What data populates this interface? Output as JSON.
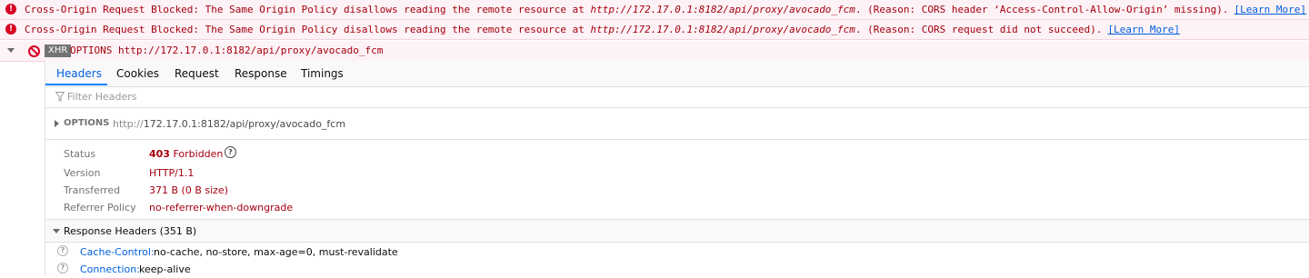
{
  "console": {
    "errors": [
      {
        "prefix": "Cross-Origin Request Blocked: The Same Origin Policy disallows reading the remote resource at ",
        "url": "http://172.17.0.1:8182/api/proxy/avocado_fcm",
        "suffix": ". (Reason: CORS header ‘Access-Control-Allow-Origin’ missing).",
        "learn_more": "[Learn More]"
      },
      {
        "prefix": "Cross-Origin Request Blocked: The Same Origin Policy disallows reading the remote resource at ",
        "url": "http://172.17.0.1:8182/api/proxy/avocado_fcm",
        "suffix": ". (Reason: CORS request did not succeed).",
        "learn_more": "[Learn More]"
      }
    ],
    "xhr": {
      "badge": "XHR",
      "text": "OPTIONS http://172.17.0.1:8182/api/proxy/avocado_fcm"
    },
    "error_icon": "!",
    "colors": {
      "error_text": "#a4000f",
      "error_bg": "#fdf2f5",
      "link": "#0060df"
    }
  },
  "panel": {
    "tabs": [
      "Headers",
      "Cookies",
      "Request",
      "Response",
      "Timings"
    ],
    "active_tab": "Headers",
    "filter_placeholder": "Filter Headers",
    "request": {
      "method": "OPTIONS",
      "url_proto": "http://",
      "url_rest": "172.17.0.1:8182/api/proxy/avocado_fcm"
    },
    "summary": {
      "status_label": "Status",
      "status_code": "403",
      "status_text": "Forbidden",
      "version_label": "Version",
      "version": "HTTP/1.1",
      "transferred_label": "Transferred",
      "transferred": "371 B (0 B size)",
      "referrer_label": "Referrer Policy",
      "referrer": "no-referrer-when-downgrade",
      "help_glyph": "?"
    },
    "response_headers": {
      "title": "Response Headers (351 B)",
      "items": [
        {
          "name": "Cache-Control:",
          "value": "no-cache, no-store, max-age=0, must-revalidate"
        },
        {
          "name": "Connection:",
          "value": "keep-alive"
        }
      ]
    }
  }
}
